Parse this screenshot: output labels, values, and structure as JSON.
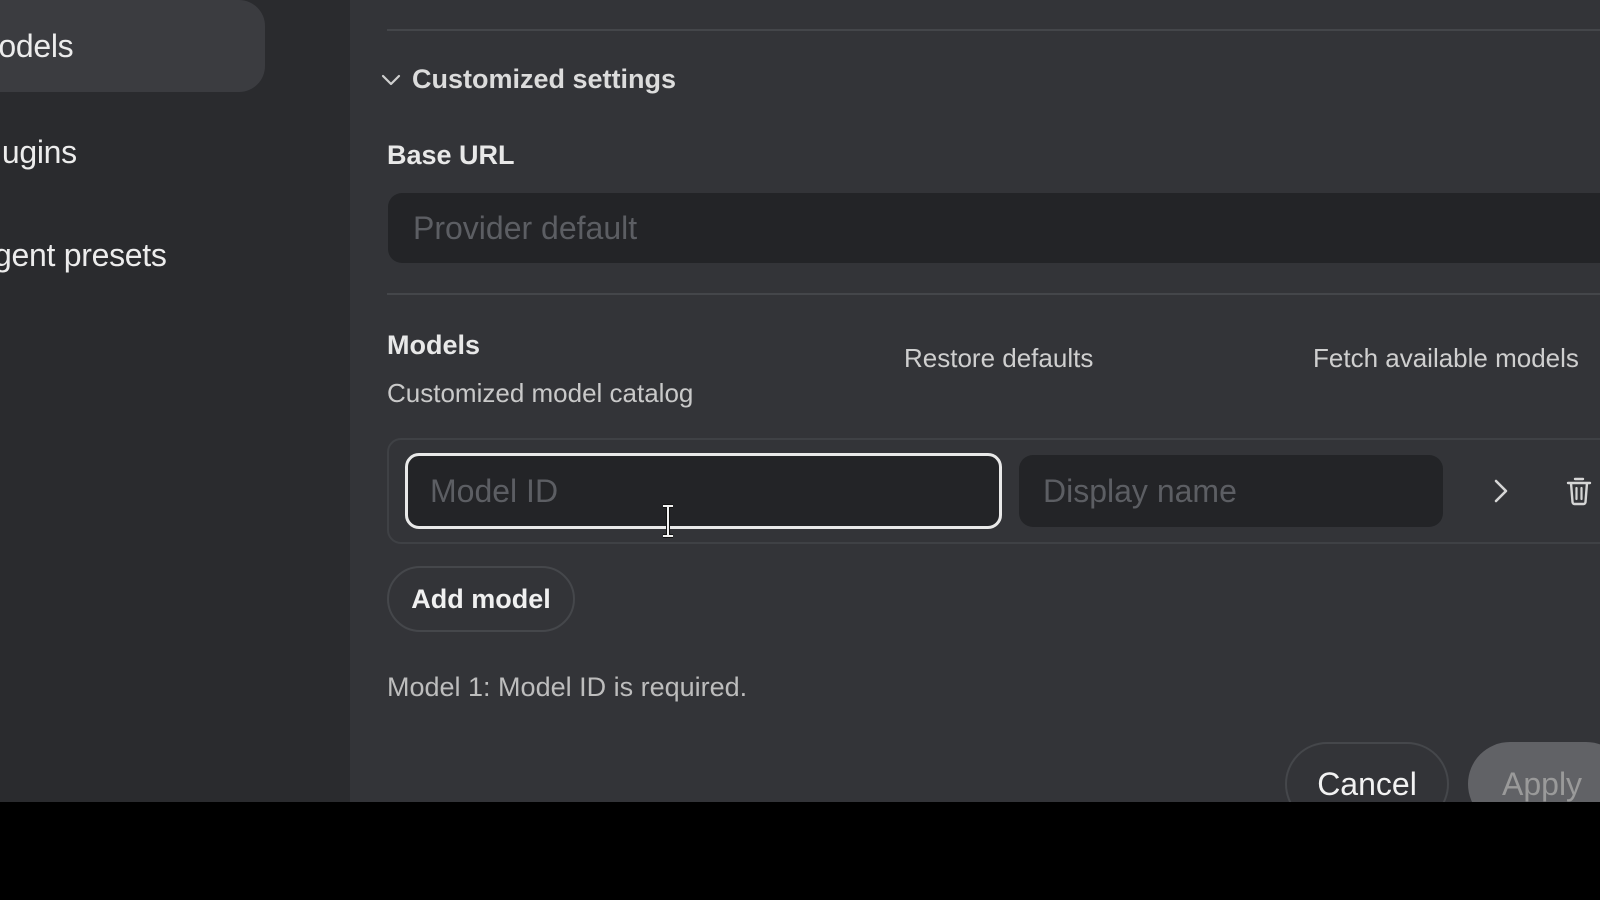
{
  "sidebar": {
    "items": [
      {
        "label": "Models",
        "icon": "",
        "active": true
      },
      {
        "label": "Plugins",
        "active": false
      },
      {
        "label": "Agent presets",
        "active": false
      }
    ]
  },
  "section": {
    "title": "Customized settings",
    "icon": "chevron-down-icon"
  },
  "base_url": {
    "label": "Base URL",
    "placeholder": "Provider default",
    "value": ""
  },
  "models": {
    "label": "Models",
    "subtitle": "Customized model catalog",
    "restore_label": "Restore defaults",
    "fetch_label": "Fetch available models",
    "rows": [
      {
        "model_id_placeholder": "Model ID",
        "model_id_value": "",
        "display_name_placeholder": "Display name",
        "display_name_value": "",
        "expand_icon": "chevron-right-icon",
        "delete_icon": "trash-icon"
      }
    ],
    "add_label": "Add model",
    "error": "Model 1: Model ID is required."
  },
  "footer": {
    "cancel_label": "Cancel",
    "apply_label": "Apply"
  },
  "colors": {
    "background": "#333438",
    "sidebar": "#2a2b2e",
    "sidebar_active": "#3b3c40",
    "input_bg": "#232427",
    "focus_border": "#e9e9e9",
    "apply_disabled": "#616266"
  }
}
